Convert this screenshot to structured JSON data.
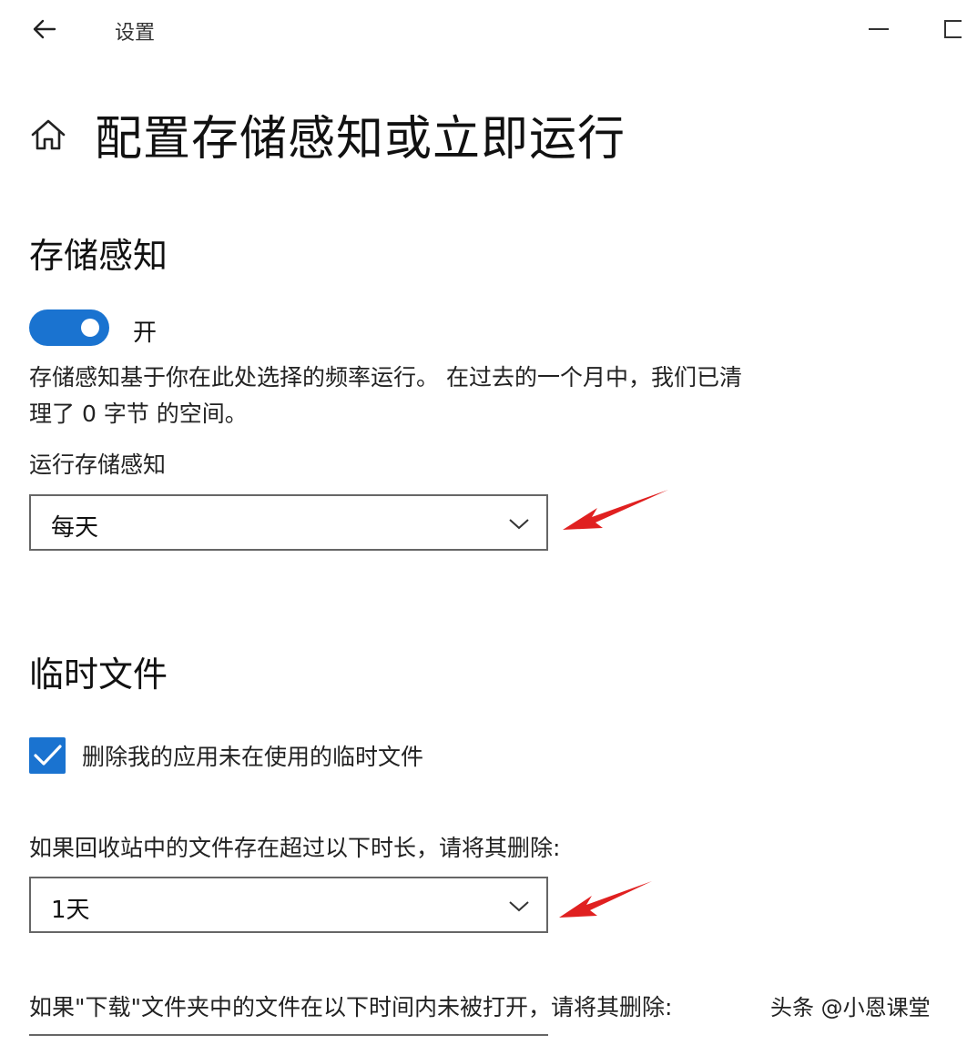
{
  "window": {
    "title": "设置",
    "back_icon": "arrow-left-icon",
    "minimize_icon": "minimize-icon",
    "maximize_icon": "maximize-icon"
  },
  "page": {
    "title": "配置存储感知或立即运行",
    "home_icon": "home-icon"
  },
  "storage_sense": {
    "section_title": "存储感知",
    "toggle_on": true,
    "toggle_label": "开",
    "description_line1": "存储感知基于你在此处选择的频率运行。 在过去的一个月中，我们已清",
    "description_line2": "理了 0 字节 的空间。",
    "run_label": "运行存储感知",
    "run_value": "每天"
  },
  "temp_files": {
    "section_title": "临时文件",
    "delete_temp_checked": true,
    "delete_temp_label": "删除我的应用未在使用的临时文件",
    "recycle_label": "如果回收站中的文件存在超过以下时长，请将其删除:",
    "recycle_value": "1天",
    "downloads_label": "如果\"下载\"文件夹中的文件在以下时间内未被打开，请将其删除:"
  },
  "watermark": "头条 @小恩课堂",
  "colors": {
    "accent": "#1a73d0",
    "arrow": "#e02020"
  }
}
